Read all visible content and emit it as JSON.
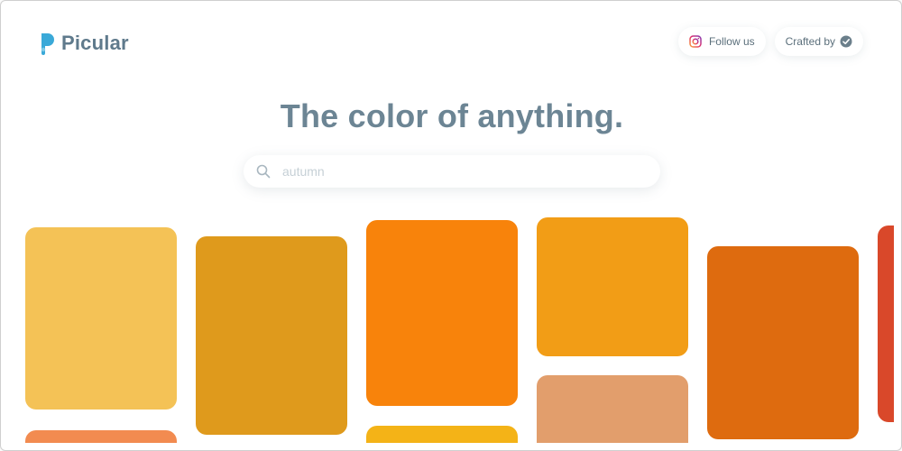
{
  "app": {
    "name": "Picular",
    "logo_icon": "droplet-icon",
    "brand_color": "#3aa9d8"
  },
  "header": {
    "follow_label": "Follow us",
    "follow_icon": "instagram-icon",
    "crafted_label": "Crafted by",
    "crafted_icon": "checkmark-badge-icon"
  },
  "hero": {
    "headline": "The color of anything."
  },
  "search": {
    "placeholder": "autumn",
    "value": ""
  },
  "swatches": [
    {
      "color": "#F4C256"
    },
    {
      "color": "#DF9A1C"
    },
    {
      "color": "#F8830B"
    },
    {
      "color": "#F29D16"
    },
    {
      "color": "#DE6B0F"
    },
    {
      "color": "#D9482A"
    },
    {
      "color": "#F28B50"
    },
    {
      "color": "#F4B317"
    },
    {
      "color": "#E29E6C"
    }
  ]
}
